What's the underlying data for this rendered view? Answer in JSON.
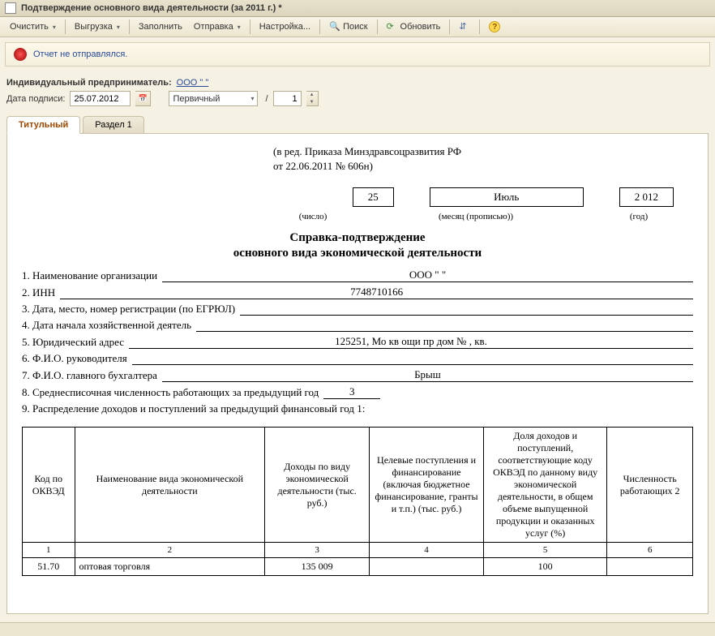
{
  "window": {
    "title": "Подтверждение основного вида деятельности  (за 2011 г.) *"
  },
  "toolbar": {
    "clear": "Очистить",
    "export": "Выгрузка",
    "fill": "Заполнить",
    "send": "Отправка",
    "settings": "Настройка...",
    "search": "Поиск",
    "refresh": "Обновить"
  },
  "status": {
    "text": "Отчет не отправлялся."
  },
  "meta": {
    "ip_label": "Индивидуальный предприниматель:",
    "ip_value": "ООО \"                          \"",
    "sign_date_label": "Дата подписи:",
    "sign_date": "25.07.2012",
    "kind": "Первичный",
    "kind_num": "1"
  },
  "tabs": [
    {
      "label": "Титульный"
    },
    {
      "label": "Раздел 1"
    }
  ],
  "doc": {
    "reg1": "(в ред. Приказа Минздравсоцразвития РФ",
    "reg2": "от 22.06.2011 № 606н)",
    "day": "25",
    "month": "Июль",
    "year": "2 012",
    "cap_day": "(число)",
    "cap_month": "(месяц (прописью))",
    "cap_year": "(год)",
    "title1": "Справка-подтверждение",
    "title2": "основного вида экономической деятельности",
    "f1_label": "1. Наименование организации",
    "f1_value": "ООО \"                          \"",
    "f2_label": "2. ИНН",
    "f2_value": "7748710166",
    "f3_label": "3. Дата, место, номер регистрации (по ЕГРЮЛ)",
    "f3_value": "                                          ",
    "f4_label": "4. Дата начала хозяйственной деятель",
    "f4_value": "",
    "f5_label": "5. Юридический адрес",
    "f5_value": "125251, Мо кв                 ощи пр         дом №   , кв.",
    "f6_label": "6. Ф.И.О. руководителя",
    "f6_value": "",
    "f7_label": "7. Ф.И.О. главного бухгалтера",
    "f7_value": "Брыш                    ",
    "f8_label": "8. Среднесписочная численность работающих за предыдущий год",
    "f8_value": "3",
    "f9_label": "9. Распределение доходов и поступлений за предыдущий финансовый год 1:"
  },
  "table": {
    "headers": [
      "Код по ОКВЭД",
      "Наименование вида экономической деятельности",
      "Доходы по виду экономической деятельности (тыс. руб.)",
      "Целевые поступления и финансирование (включая бюджетное финансирование, гранты и т.п.) (тыс. руб.)",
      "Доля доходов и поступлений, соответствующие коду ОКВЭД по данному виду экономической деятельности, в общем объеме выпущенной продукции и оказанных услуг (%)",
      "Численность работающих 2"
    ],
    "colnums": [
      "1",
      "2",
      "3",
      "4",
      "5",
      "6"
    ],
    "rows": [
      {
        "c1": "51.70",
        "c2": "оптовая торговля",
        "c3": "135 009",
        "c4": "",
        "c5": "100",
        "c6": ""
      }
    ]
  }
}
